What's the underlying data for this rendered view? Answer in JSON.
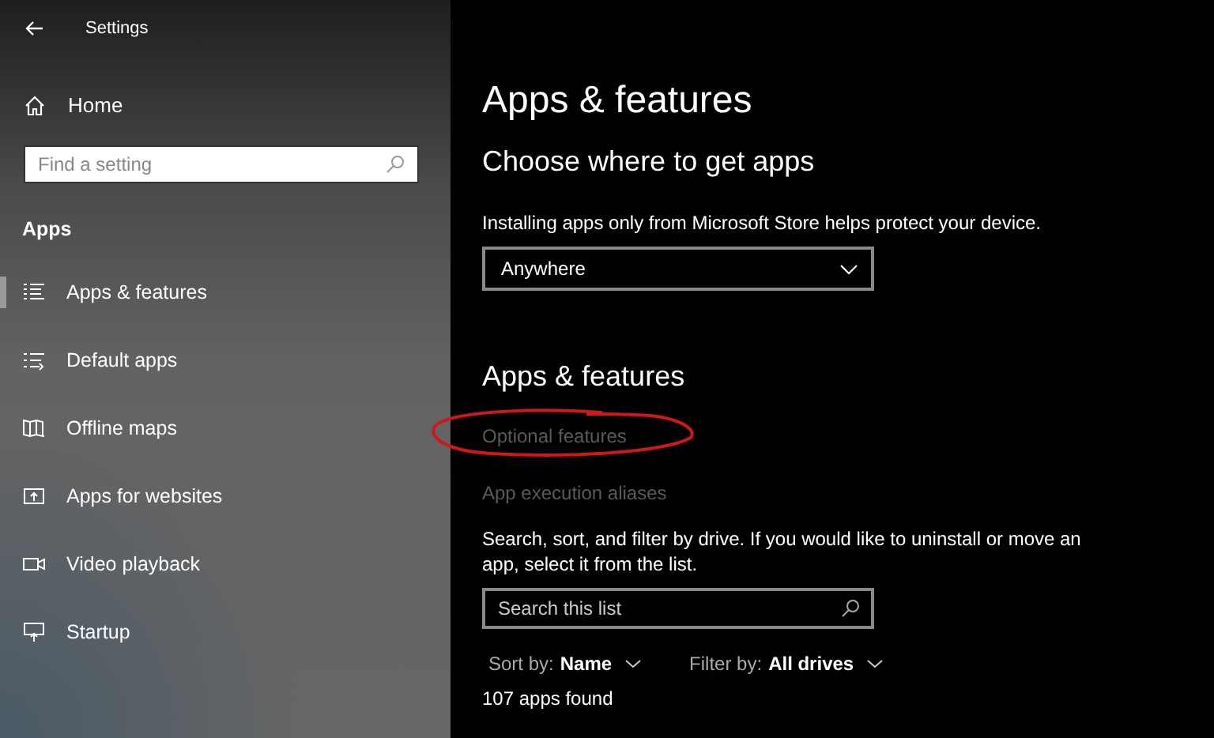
{
  "window": {
    "title": "Settings"
  },
  "sidebar": {
    "home": "Home",
    "search": {
      "placeholder": "Find a setting"
    },
    "section": "Apps",
    "items": [
      {
        "label": "Apps & features",
        "selected": true
      },
      {
        "label": "Default apps",
        "selected": false
      },
      {
        "label": "Offline maps",
        "selected": false
      },
      {
        "label": "Apps for websites",
        "selected": false
      },
      {
        "label": "Video playback",
        "selected": false
      },
      {
        "label": "Startup",
        "selected": false
      }
    ]
  },
  "main": {
    "title": "Apps & features",
    "source_heading": "Choose where to get apps",
    "source_text": "Installing apps only from Microsoft Store helps protect your device.",
    "source_dropdown": "Anywhere",
    "features_heading": "Apps & features",
    "links": [
      {
        "label": "Optional features",
        "circled": true
      },
      {
        "label": "App execution aliases",
        "circled": false
      }
    ],
    "description": "Search, sort, and filter by drive. If you would like to uninstall or move an app, select it from the list.",
    "search": {
      "placeholder": "Search this list"
    },
    "sort": {
      "label": "Sort by:",
      "value": "Name"
    },
    "filter": {
      "label": "Filter by:",
      "value": "All drives"
    },
    "count": "107 apps found"
  }
}
